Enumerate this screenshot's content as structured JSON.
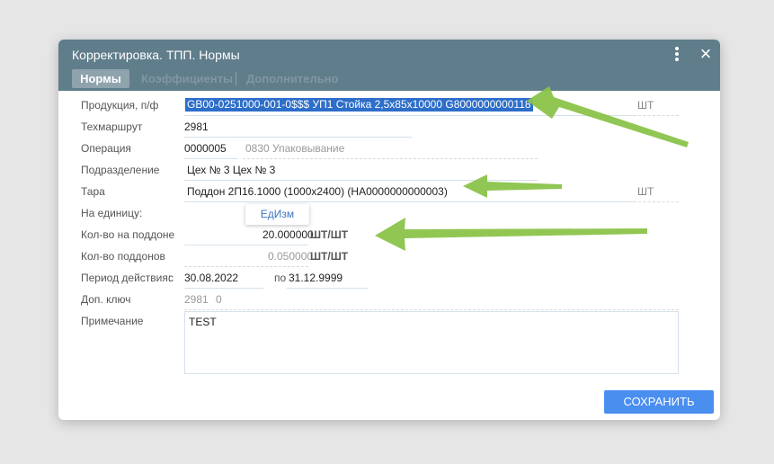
{
  "dialog": {
    "title": "Корректировка. ТПП. Нормы",
    "menu_icon": "more-vert-icon",
    "close_icon": "×"
  },
  "tabs": [
    {
      "label": "Нормы",
      "active": true
    },
    {
      "label": "Коэффициенты",
      "active": false
    },
    {
      "label": "Дополнительно",
      "active": false
    }
  ],
  "form": {
    "product": {
      "label": "Продукция, п/ф",
      "value": "GB00-0251000-001-0$$$ УП1 Стойка 2,5x85x10000 G8000000000118",
      "unit": "ШТ"
    },
    "route": {
      "label": "Техмаршрут",
      "value": "2981"
    },
    "operation": {
      "label": "Операция",
      "code": "0000005",
      "name": "0830 Упаковывание"
    },
    "department": {
      "label": "Подразделение",
      "value": "Цех № 3 Цех № 3"
    },
    "tare": {
      "label": "Тара",
      "value": "Поддон 2П16.1000 (1000x2400) (НА0000000000003)",
      "unit": "ШТ"
    },
    "per_unit": {
      "label": "На единицу:",
      "button": "ЕдИзм"
    },
    "qty_pallet": {
      "label": "Кол-во на поддоне",
      "value": "20.000000",
      "unit": "ШТ/ШТ"
    },
    "qty_pallets": {
      "label": "Кол-во поддонов",
      "value": "0.050000",
      "unit": "ШТ/ШТ"
    },
    "period": {
      "label": "Период действия:",
      "from_label": "с",
      "from": "30.08.2022",
      "to_label": "по",
      "to": "31.12.9999"
    },
    "extra_key": {
      "label": "Доп. ключ",
      "value1": "2981",
      "value2": "0"
    },
    "note": {
      "label": "Примечание",
      "value": "TEST"
    }
  },
  "save_button": "СОХРАНИТЬ",
  "colors": {
    "header": "#607d8b",
    "tab_active": "#8fa3ad",
    "selection": "#2d6ec9",
    "save_button": "#4a8ef0",
    "arrow": "#8bc34a"
  }
}
